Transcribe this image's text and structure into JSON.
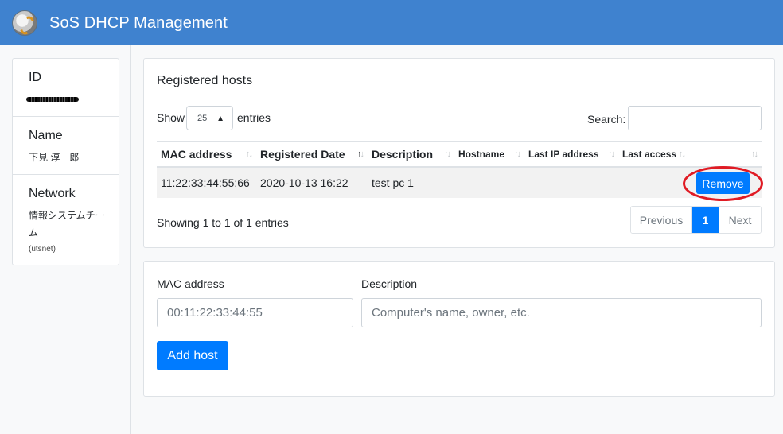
{
  "app": {
    "title": "SoS DHCP Management"
  },
  "sidebar": {
    "id_label": "ID",
    "name_label": "Name",
    "name_value": "下見 淳一郎",
    "network_label": "Network",
    "network_value": "情報システムチーム",
    "network_code": "(utsnet)"
  },
  "hosts": {
    "title": "Registered hosts",
    "show_label": "Show",
    "page_length": "25",
    "entries_label": "entries",
    "search_label": "Search:",
    "columns": [
      "MAC address",
      "Registered Date",
      "Description",
      "Hostname",
      "Last IP address",
      "Last access"
    ],
    "rows": [
      {
        "mac": "11:22:33:44:55:66",
        "date": "2020-10-13 16:22",
        "description": "test pc 1",
        "hostname": "",
        "last_ip": "",
        "last_access": ""
      }
    ],
    "remove_label": "Remove",
    "info": "Showing 1 to 1 of 1 entries",
    "pagination": {
      "previous": "Previous",
      "current": "1",
      "next": "Next"
    }
  },
  "add_form": {
    "mac_label": "MAC address",
    "mac_placeholder": "00:11:22:33:44:55",
    "desc_label": "Description",
    "desc_placeholder": "Computer's name, owner, etc.",
    "submit_label": "Add host"
  },
  "colors": {
    "navbar": "#3f82cf",
    "primary": "#007bff",
    "annotation": "#e01b24"
  }
}
